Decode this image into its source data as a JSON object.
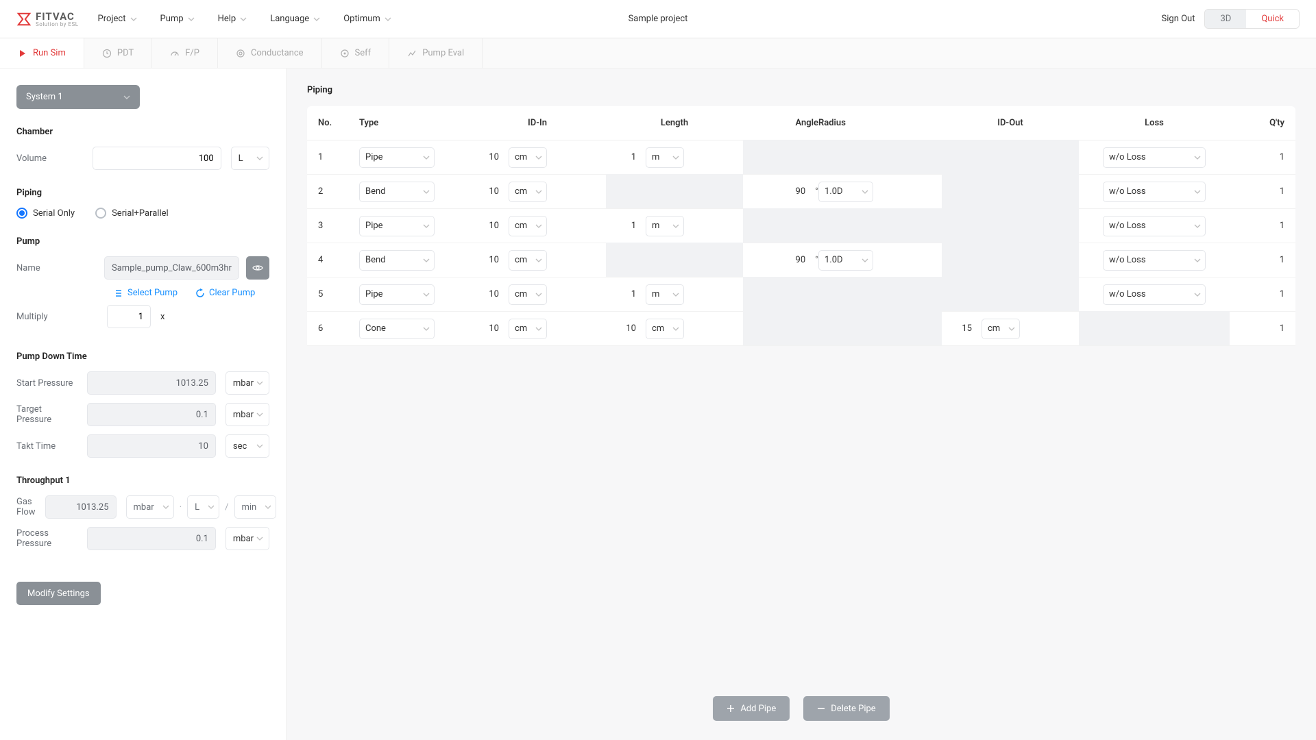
{
  "brand": {
    "name": "FITVAC",
    "tagline": "Solution by ESL"
  },
  "menu": [
    "Project",
    "Pump",
    "Help",
    "Language",
    "Optimum"
  ],
  "project_name": "Sample project",
  "header": {
    "signout": "Sign Out",
    "view3d": "3D",
    "viewQuick": "Quick"
  },
  "subtabs": [
    {
      "label": "Run Sim",
      "icon": "play",
      "active": true
    },
    {
      "label": "PDT",
      "icon": "clock"
    },
    {
      "label": "F/P",
      "icon": "gauge"
    },
    {
      "label": "Conductance",
      "icon": "ring"
    },
    {
      "label": "Seff",
      "icon": "target"
    },
    {
      "label": "Pump Eval",
      "icon": "spark"
    }
  ],
  "sidebar": {
    "system_selector": "System 1",
    "chamber": {
      "heading": "Chamber",
      "volume_label": "Volume",
      "volume_value": "100",
      "volume_unit": "L"
    },
    "piping": {
      "heading": "Piping",
      "opt_serial": "Serial Only",
      "opt_parallel": "Serial+Parallel"
    },
    "pump": {
      "heading": "Pump",
      "name_label": "Name",
      "name_value": "Sample_pump_Claw_600m3hr",
      "select_pump": "Select Pump",
      "clear_pump": "Clear Pump",
      "multiply_label": "Multiply",
      "multiply_value": "1",
      "multiply_suffix": "x"
    },
    "pdt": {
      "heading": "Pump Down Time",
      "start_p_label": "Start Pressure",
      "start_p_value": "1013.25",
      "start_p_unit": "mbar",
      "target_p_label": "Target Pressure",
      "target_p_value": "0.1",
      "target_p_unit": "mbar",
      "takt_label": "Takt Time",
      "takt_value": "10",
      "takt_unit": "sec"
    },
    "tp": {
      "heading": "Throughput 1",
      "gas_label": "Gas Flow",
      "gas_value": "1013.25",
      "gas_u1": "mbar",
      "gas_u2": "L",
      "gas_u3": "min",
      "pp_label": "Process Pressure",
      "pp_value": "0.1",
      "pp_unit": "mbar"
    },
    "modify_btn": "Modify Settings"
  },
  "table": {
    "title": "Piping",
    "cols": {
      "no": "No.",
      "type": "Type",
      "idin": "ID-In",
      "length": "Length",
      "angle": "Angle",
      "radius": "Radius",
      "idout": "ID-Out",
      "loss": "Loss",
      "qty": "Q'ty"
    },
    "rows": [
      {
        "no": "1",
        "type": "Pipe",
        "idin_v": "10",
        "idin_u": "cm",
        "len_v": "1",
        "len_u": "m",
        "angle_v": "",
        "angle_u": "",
        "radius": "",
        "idout_v": "",
        "idout_u": "",
        "loss": "w/o Loss",
        "qty": "1",
        "na_len": false,
        "na_ang": true,
        "na_out": true,
        "na_loss": false
      },
      {
        "no": "2",
        "type": "Bend",
        "idin_v": "10",
        "idin_u": "cm",
        "len_v": "",
        "len_u": "",
        "angle_v": "90",
        "angle_u": "°",
        "radius": "1.0D",
        "idout_v": "",
        "idout_u": "",
        "loss": "w/o Loss",
        "qty": "1",
        "na_len": true,
        "na_ang": false,
        "na_out": true,
        "na_loss": false
      },
      {
        "no": "3",
        "type": "Pipe",
        "idin_v": "10",
        "idin_u": "cm",
        "len_v": "1",
        "len_u": "m",
        "angle_v": "",
        "angle_u": "",
        "radius": "",
        "idout_v": "",
        "idout_u": "",
        "loss": "w/o Loss",
        "qty": "1",
        "na_len": false,
        "na_ang": true,
        "na_out": true,
        "na_loss": false
      },
      {
        "no": "4",
        "type": "Bend",
        "idin_v": "10",
        "idin_u": "cm",
        "len_v": "",
        "len_u": "",
        "angle_v": "90",
        "angle_u": "°",
        "radius": "1.0D",
        "idout_v": "",
        "idout_u": "",
        "loss": "w/o Loss",
        "qty": "1",
        "na_len": true,
        "na_ang": false,
        "na_out": true,
        "na_loss": false
      },
      {
        "no": "5",
        "type": "Pipe",
        "idin_v": "10",
        "idin_u": "cm",
        "len_v": "1",
        "len_u": "m",
        "angle_v": "",
        "angle_u": "",
        "radius": "",
        "idout_v": "",
        "idout_u": "",
        "loss": "w/o Loss",
        "qty": "1",
        "na_len": false,
        "na_ang": true,
        "na_out": true,
        "na_loss": false
      },
      {
        "no": "6",
        "type": "Cone",
        "idin_v": "10",
        "idin_u": "cm",
        "len_v": "10",
        "len_u": "cm",
        "angle_v": "",
        "angle_u": "",
        "radius": "",
        "idout_v": "15",
        "idout_u": "cm",
        "loss": "",
        "qty": "1",
        "na_len": false,
        "na_ang": true,
        "na_out": false,
        "na_loss": true
      }
    ],
    "add_btn": "Add Pipe",
    "del_btn": "Delete Pipe"
  }
}
